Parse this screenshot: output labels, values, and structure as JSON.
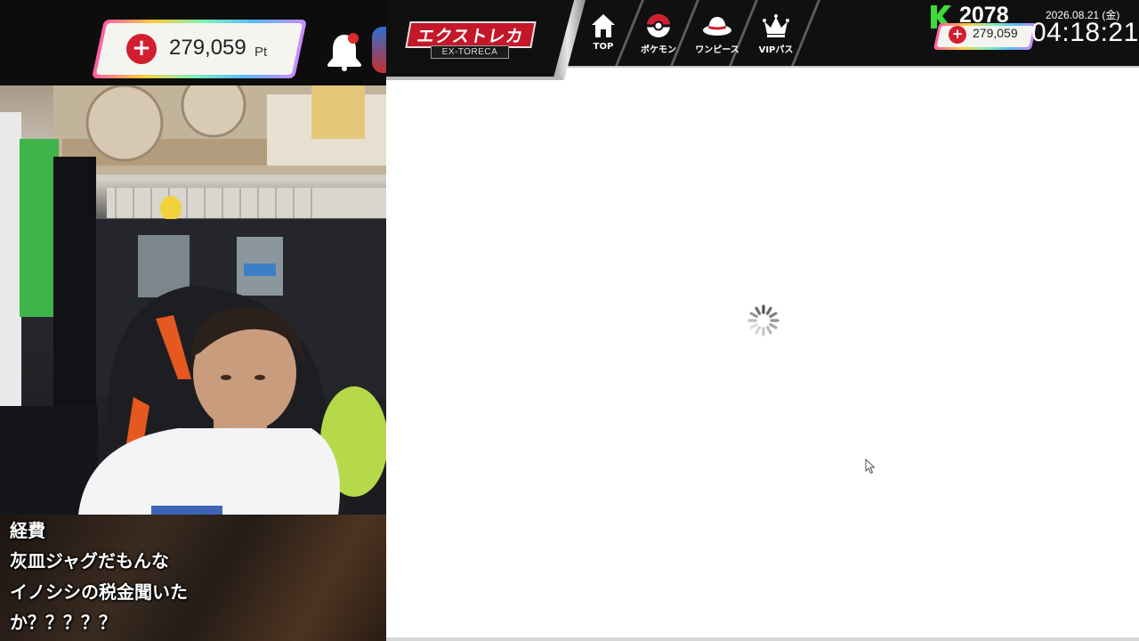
{
  "stream_overlay": {
    "points": {
      "value": "279,059",
      "unit": "Pt"
    },
    "comments": [
      "経費",
      "灰皿ジャグだもんな",
      "イノシシの税金聞いた",
      "か？？？？？"
    ]
  },
  "site": {
    "logo": {
      "main": "エクストレカ",
      "sub": "EX-TORECA"
    },
    "nav": [
      {
        "label": "TOP",
        "icon": "home-icon"
      },
      {
        "label": "ポケモン",
        "icon": "pokeball-icon"
      },
      {
        "label": "ワンピース",
        "icon": "straw-hat-icon"
      },
      {
        "label": "VIPパス",
        "icon": "crown-icon"
      }
    ],
    "rank": "2078",
    "points": "279,059",
    "clock": {
      "date": "2026.08.21 (金)",
      "time": "04:18:21"
    }
  },
  "colors": {
    "accent_red": "#d21f2f",
    "header_bg": "#101011",
    "logo_red": "#c5172a"
  }
}
